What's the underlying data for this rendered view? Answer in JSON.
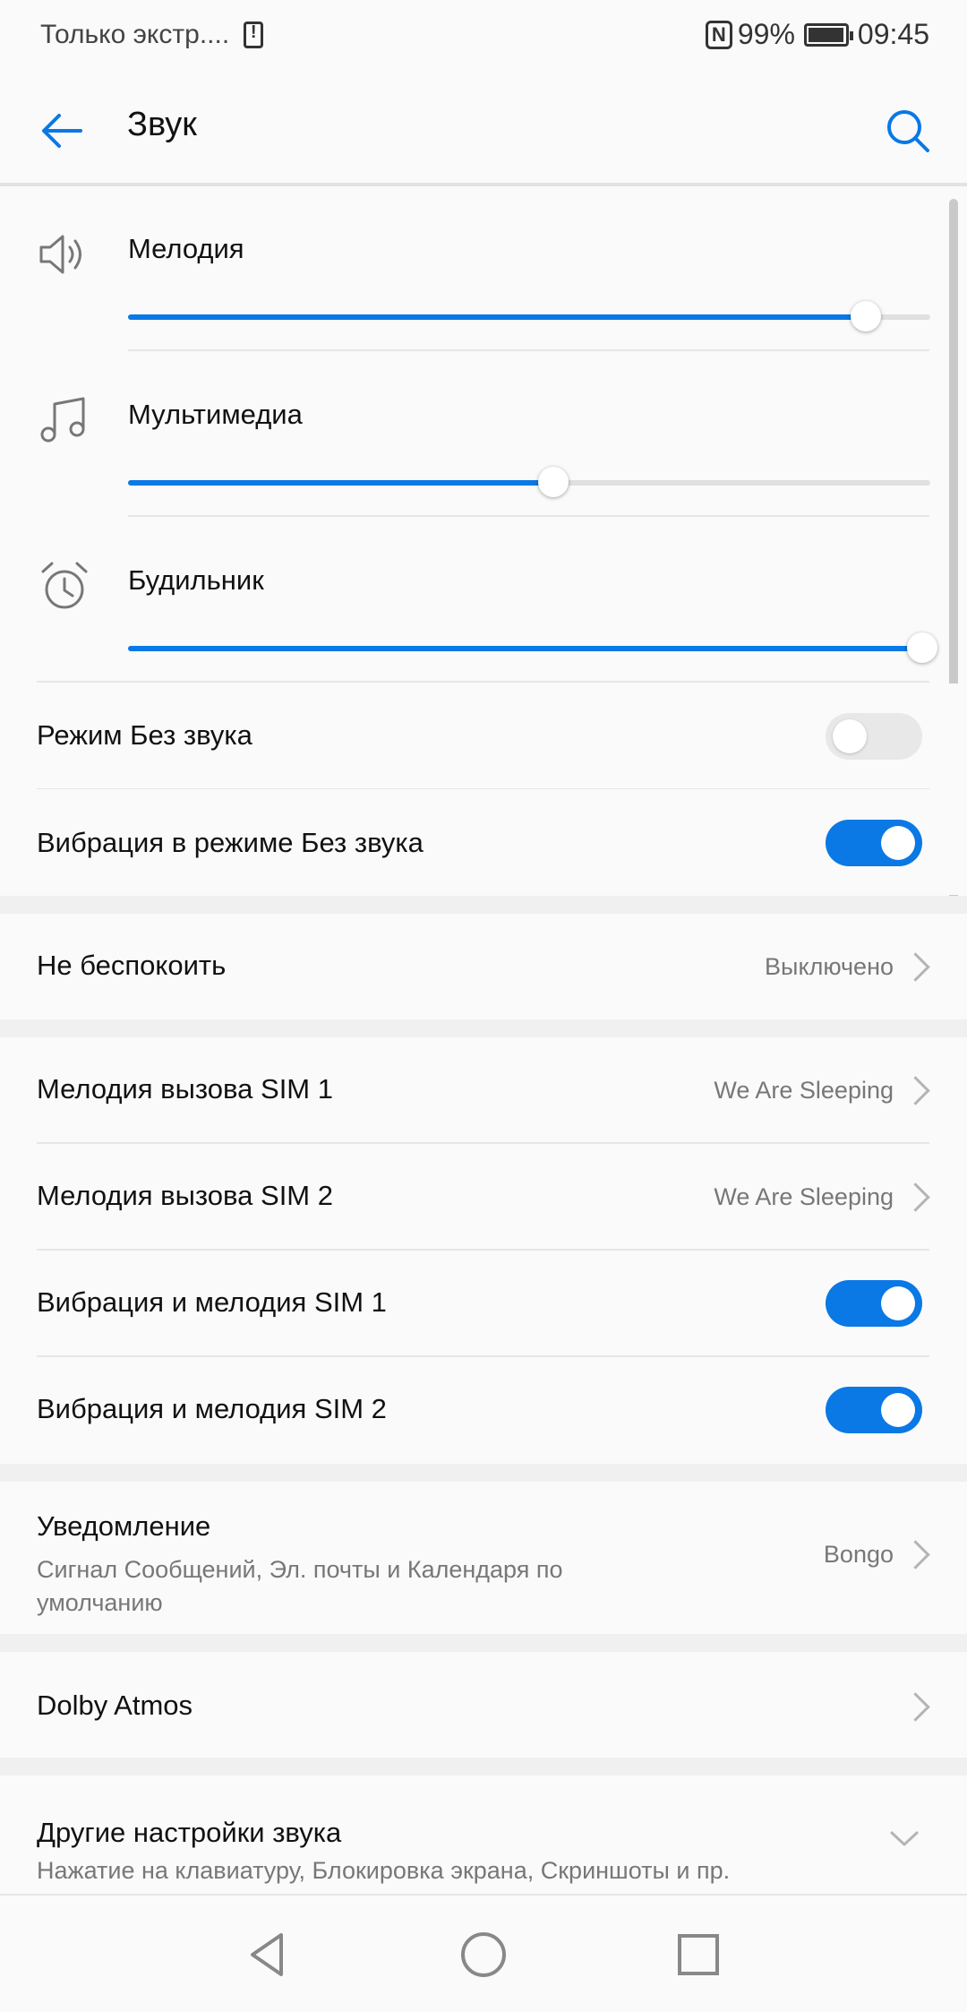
{
  "status_bar": {
    "carrier_text": "Только экстр....",
    "nfc_label": "N",
    "battery": "99%",
    "time": "09:45"
  },
  "app_bar": {
    "title": "Звук",
    "back_icon": "arrow-left-icon",
    "search_icon": "search-icon"
  },
  "volume": [
    {
      "label": "Мелодия",
      "icon": "speaker-icon",
      "level": 0.92
    },
    {
      "label": "Мультимедиа",
      "icon": "music-note-icon",
      "level": 0.53
    },
    {
      "label": "Будильник",
      "icon": "alarm-clock-icon",
      "level": 0.99
    }
  ],
  "toggles": {
    "silent_mode": {
      "label": "Режим Без звука",
      "on": false
    },
    "vibrate_silent": {
      "label": "Вибрация в режиме Без звука",
      "on": true
    }
  },
  "dnd": {
    "label": "Не беспокоить",
    "value": "Выключено"
  },
  "sim_ringtones": [
    {
      "label": "Мелодия вызова SIM 1",
      "value": "We Are Sleeping"
    },
    {
      "label": "Мелодия вызова SIM 2",
      "value": "We Are Sleeping"
    }
  ],
  "sim_vibration": [
    {
      "label": "Вибрация и мелодия SIM 1",
      "on": true
    },
    {
      "label": "Вибрация и мелодия SIM 2",
      "on": true
    }
  ],
  "notification": {
    "label": "Уведомление",
    "subtitle": "Сигнал Сообщений, Эл. почты и Календаря по умолчанию",
    "value": "Bongo"
  },
  "dolby": {
    "label": "Dolby Atmos"
  },
  "other": {
    "label": "Другие настройки звука",
    "subtitle": "Нажатие на клавиатуру, Блокировка экрана, Скриншоты и пр."
  },
  "nav_bar": [
    "back-triangle-icon",
    "home-circle-icon",
    "recents-square-icon"
  ],
  "colors": {
    "accent": "#0a78e5",
    "background": "#fafafa",
    "section_gap": "#f0f0f0"
  }
}
